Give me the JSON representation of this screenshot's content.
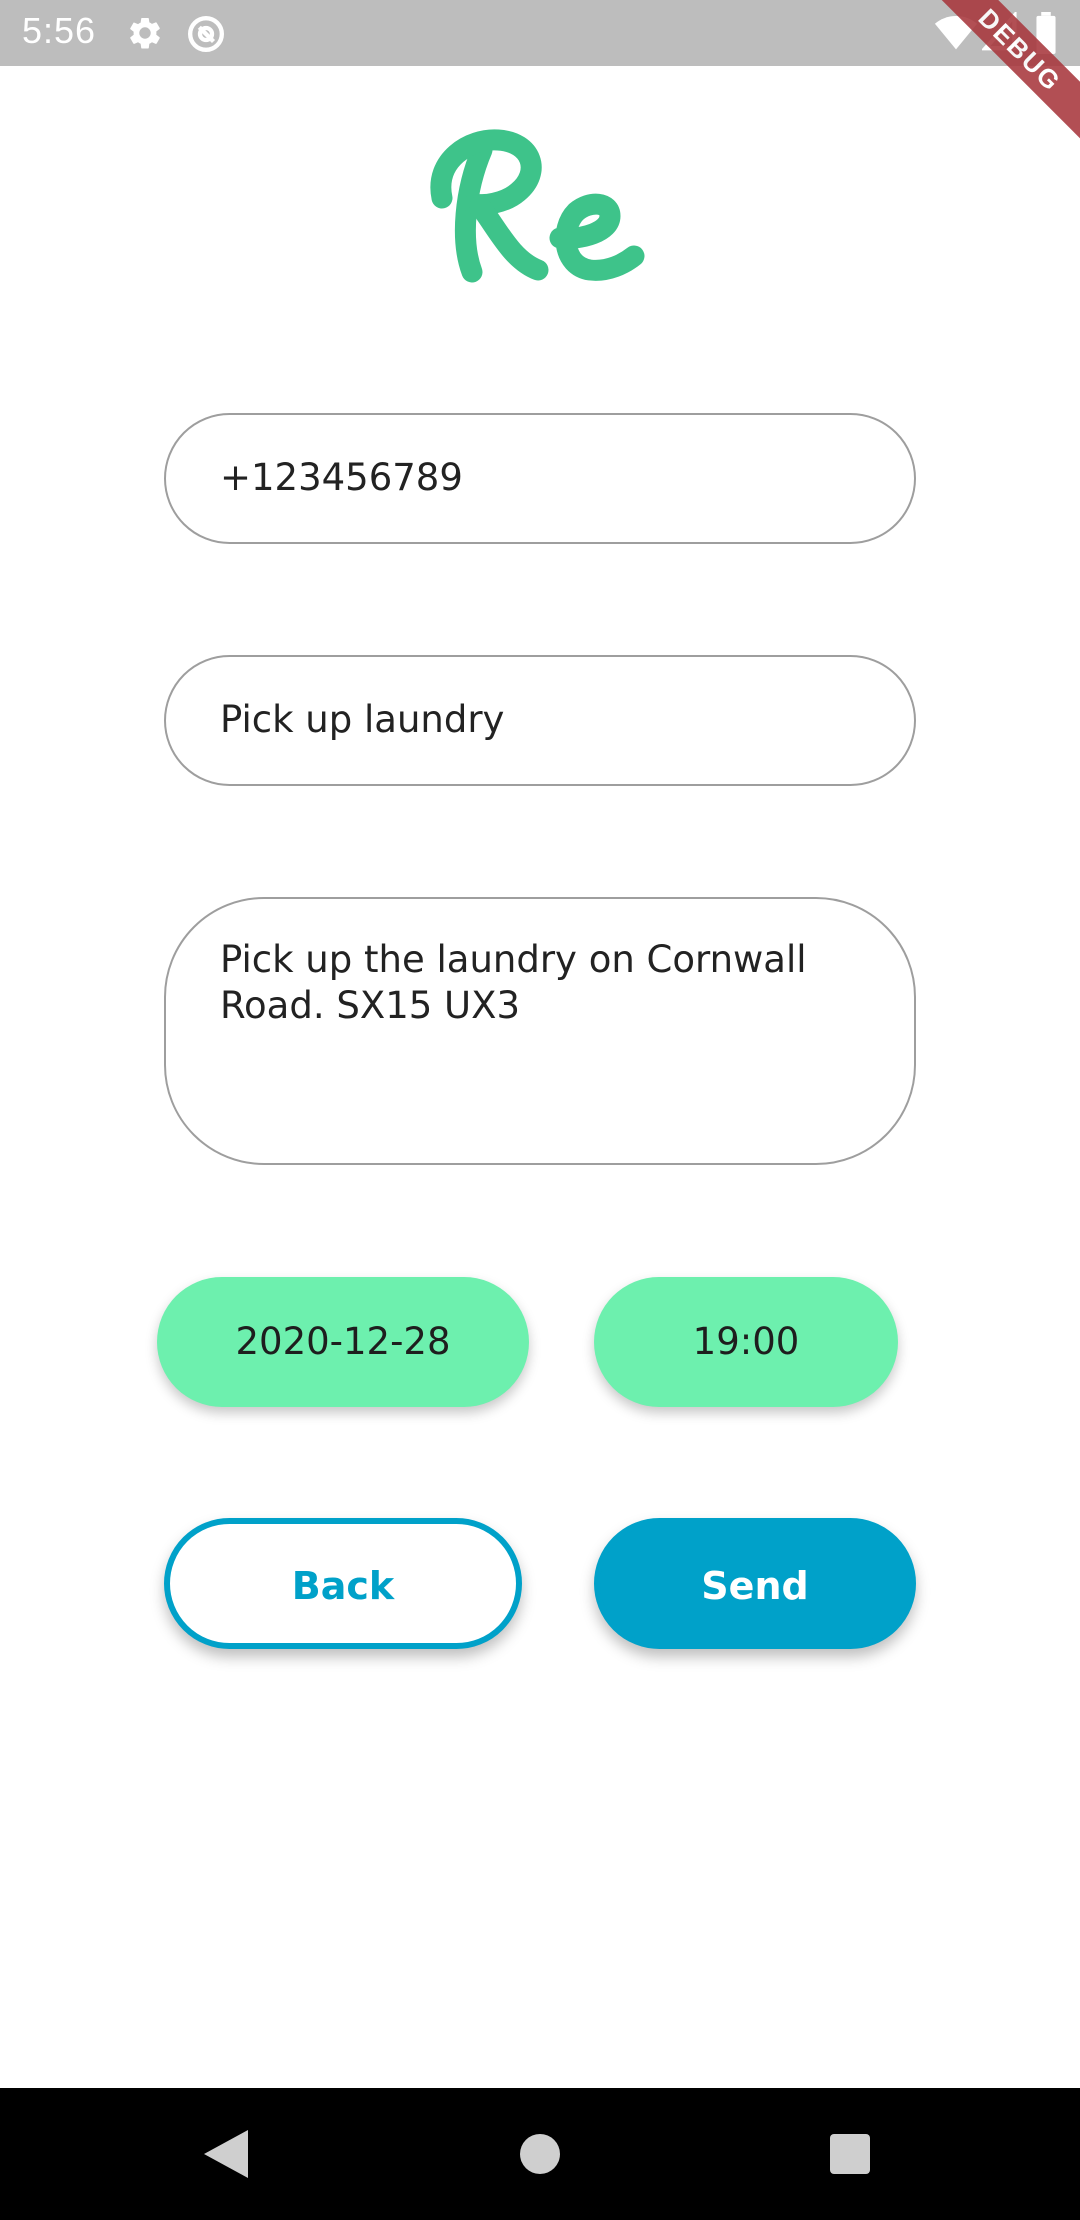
{
  "status_bar": {
    "time": "5:56",
    "left_icons": [
      "settings-icon",
      "at-sign-icon"
    ],
    "right_icons": [
      "wifi-icon",
      "signal-icon",
      "battery-icon"
    ],
    "background": "#bdbdbd"
  },
  "debug_banner": "DEBUG",
  "logo": {
    "text": "Re",
    "color": "#3ec38a"
  },
  "form": {
    "phone_value": "+123456789",
    "title_value": "Pick up laundry",
    "description_value": "Pick up the laundry on Cornwall Road. SX15 UX3"
  },
  "schedule": {
    "date": "2020-12-28",
    "time": "19:00",
    "chip_color": "#6df0ae"
  },
  "actions": {
    "back_label": "Back",
    "send_label": "Send",
    "accent": "#00a1c9"
  },
  "nav_bar": {
    "buttons": [
      "back-triangle-icon",
      "home-circle-icon",
      "recents-square-icon"
    ]
  }
}
